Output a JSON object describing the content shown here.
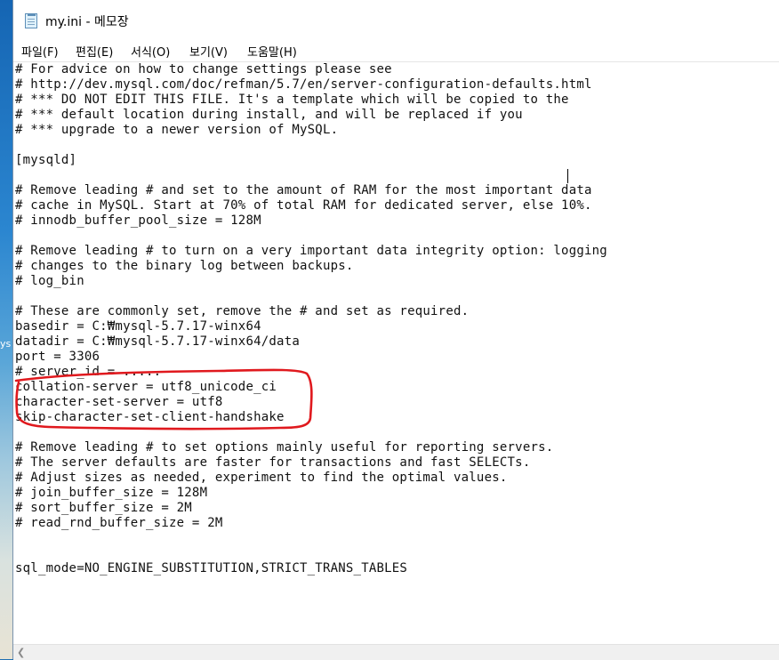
{
  "window": {
    "title": "my.ini - 메모장"
  },
  "desktop": {
    "label": "ys"
  },
  "menu": [
    {
      "label": "파일(F)"
    },
    {
      "label": "편집(E)"
    },
    {
      "label": "서식(O)"
    },
    {
      "label": "보기(V)"
    },
    {
      "label": "도움말(H)"
    }
  ],
  "editor": {
    "lines": [
      "# For advice on how to change settings please see",
      "# http://dev.mysql.com/doc/refman/5.7/en/server-configuration-defaults.html",
      "# *** DO NOT EDIT THIS FILE. It's a template which will be copied to the",
      "# *** default location during install, and will be replaced if you",
      "# *** upgrade to a newer version of MySQL.",
      "",
      "[mysqld]",
      "",
      "# Remove leading # and set to the amount of RAM for the most important data",
      "# cache in MySQL. Start at 70% of total RAM for dedicated server, else 10%.",
      "# innodb_buffer_pool_size = 128M",
      "",
      "# Remove leading # to turn on a very important data integrity option: logging",
      "# changes to the binary log between backups.",
      "# log_bin",
      "",
      "# These are commonly set, remove the # and set as required.",
      "basedir = C:₩mysql-5.7.17-winx64",
      "datadir = C:₩mysql-5.7.17-winx64/data",
      "port = 3306",
      "# server_id = .....",
      "collation-server = utf8_unicode_ci",
      "character-set-server = utf8",
      "skip-character-set-client-handshake",
      "",
      "# Remove leading # to set options mainly useful for reporting servers.",
      "# The server defaults are faster for transactions and fast SELECTs.",
      "# Adjust sizes as needed, experiment to find the optimal values.",
      "# join_buffer_size = 128M",
      "# sort_buffer_size = 2M",
      "# read_rnd_buffer_size = 2M",
      "",
      "",
      "sql_mode=NO_ENGINE_SUBSTITUTION,STRICT_TRANS_TABLES"
    ]
  },
  "colors": {
    "annotation": "#e0191e",
    "text": "#111111"
  }
}
